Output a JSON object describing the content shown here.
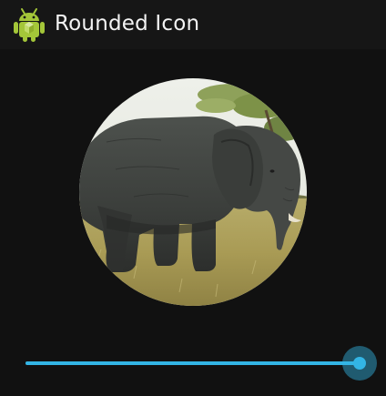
{
  "action_bar": {
    "icon": "android-robot-icon",
    "title": "Rounded Icon"
  },
  "image": {
    "subject": "elephant-photo"
  },
  "slider": {
    "value": 1.0,
    "track_color": "#33b5e5",
    "thumb_color": "#33b5e5"
  }
}
